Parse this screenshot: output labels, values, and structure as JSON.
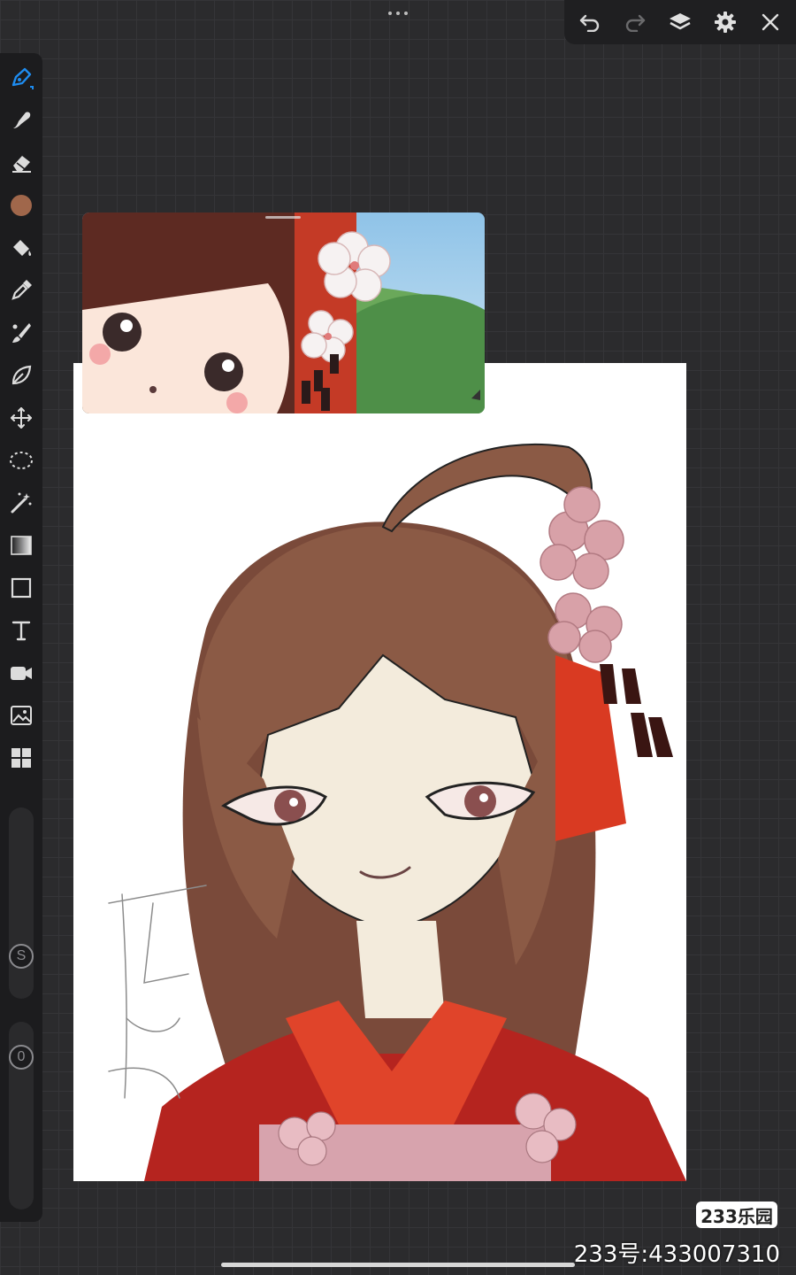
{
  "app": {
    "accent": "#1e8cf0",
    "current_color": "#a0674b"
  },
  "topbar": {
    "undo_icon": "undo-icon",
    "redo_icon": "redo-icon",
    "layers_icon": "layers-icon",
    "settings_icon": "gear-icon",
    "close_icon": "close-icon"
  },
  "toolbar": {
    "tools": [
      "brush",
      "smudge",
      "eraser",
      "color",
      "fill",
      "eyedropper",
      "mixer",
      "liquify",
      "transform",
      "lasso",
      "magic-wand",
      "gradient",
      "shape",
      "text",
      "video",
      "image",
      "layout"
    ],
    "size_slider_label": "S",
    "opacity_slider_label": "0"
  },
  "watermark": {
    "logo": "233乐园",
    "id_text": "233号:433007310"
  }
}
